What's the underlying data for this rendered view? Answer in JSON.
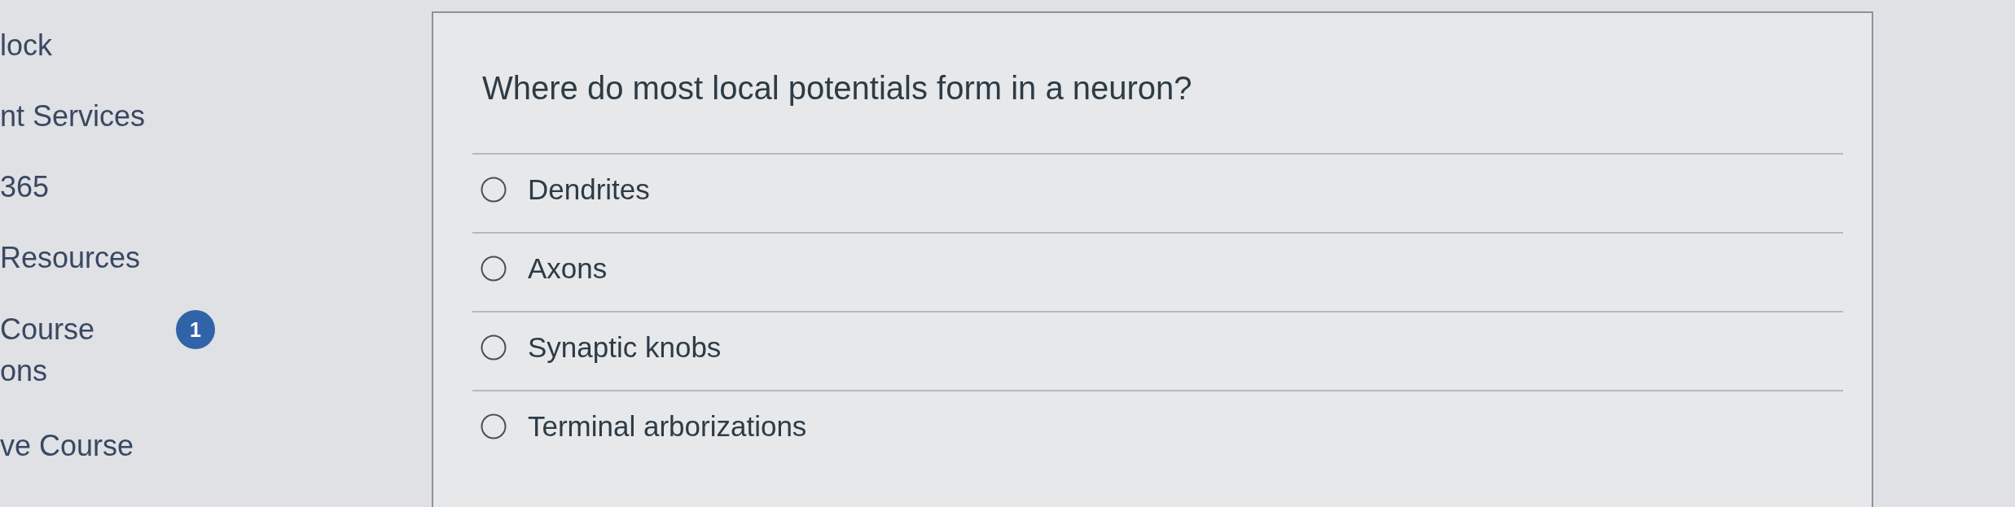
{
  "sidebar": {
    "items": [
      {
        "lines": [
          "lock"
        ]
      },
      {
        "lines": [
          "nt Services"
        ]
      },
      {
        "lines": [
          "365"
        ]
      },
      {
        "lines": [
          "Resources"
        ]
      },
      {
        "lines": [
          "Course",
          "ons"
        ],
        "badge": "1"
      },
      {
        "lines": [
          "ve Course"
        ]
      }
    ]
  },
  "question": {
    "text": "Where do most local potentials form in a neuron?",
    "options": [
      {
        "label": "Dendrites",
        "selected": false
      },
      {
        "label": "Axons",
        "selected": false
      },
      {
        "label": "Synaptic knobs",
        "selected": false
      },
      {
        "label": "Terminal arborizations",
        "selected": false
      }
    ]
  }
}
